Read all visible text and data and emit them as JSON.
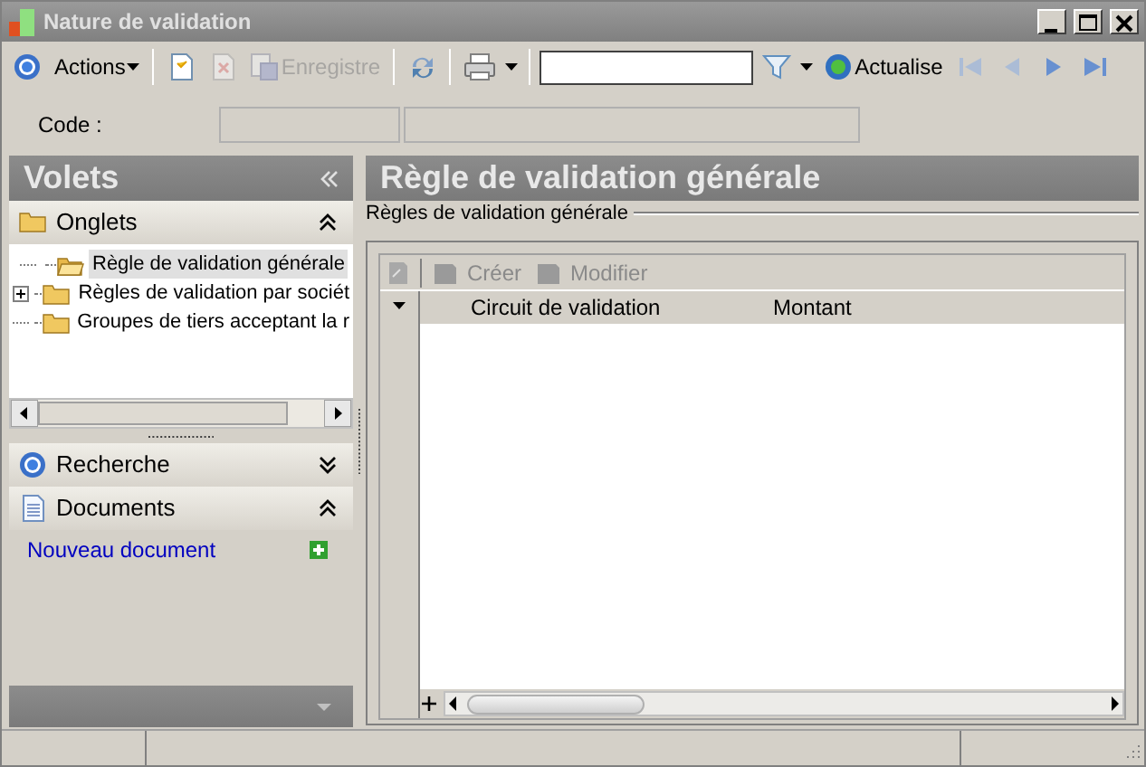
{
  "window": {
    "title": "Nature de validation"
  },
  "toolbar": {
    "items": [
      {
        "kind": "actions",
        "label": "Actions",
        "disabled": false
      },
      {
        "kind": "new",
        "disabled": false
      },
      {
        "kind": "delete",
        "disabled": true
      },
      {
        "kind": "save",
        "label": "Enregistre",
        "disabled": true
      },
      {
        "kind": "refresh",
        "disabled": false
      },
      {
        "kind": "print",
        "disabled": false
      },
      {
        "kind": "search"
      },
      {
        "kind": "filter",
        "disabled": false
      },
      {
        "kind": "reload",
        "label": "Actualise",
        "disabled": false
      },
      {
        "kind": "first",
        "disabled": true
      },
      {
        "kind": "prev",
        "disabled": true
      },
      {
        "kind": "next",
        "disabled": false
      },
      {
        "kind": "last",
        "disabled": false
      }
    ]
  },
  "code": {
    "label": "Code :"
  },
  "sidebar": {
    "title": "Volets",
    "tabs_section": {
      "title": "Onglets",
      "expanded": true,
      "tree": [
        {
          "label": "Règle de validation générale",
          "selected": true,
          "expandable": false
        },
        {
          "label": "Règles de validation par sociét",
          "selected": false,
          "expandable": true
        },
        {
          "label": "Groupes de tiers acceptant la r",
          "selected": false,
          "expandable": false
        }
      ]
    },
    "search_section": {
      "title": "Recherche",
      "expanded": false
    },
    "documents_section": {
      "title": "Documents",
      "expanded": true,
      "link": "Nouveau document"
    }
  },
  "main": {
    "title": "Règle de validation générale",
    "group": "Règles de validation générale",
    "grid_toolbar": [
      {
        "label": "Créer",
        "disabled": true
      },
      {
        "label": "Modifier",
        "disabled": true
      }
    ],
    "columns": [
      "Circuit de validation",
      "Montant"
    ]
  }
}
